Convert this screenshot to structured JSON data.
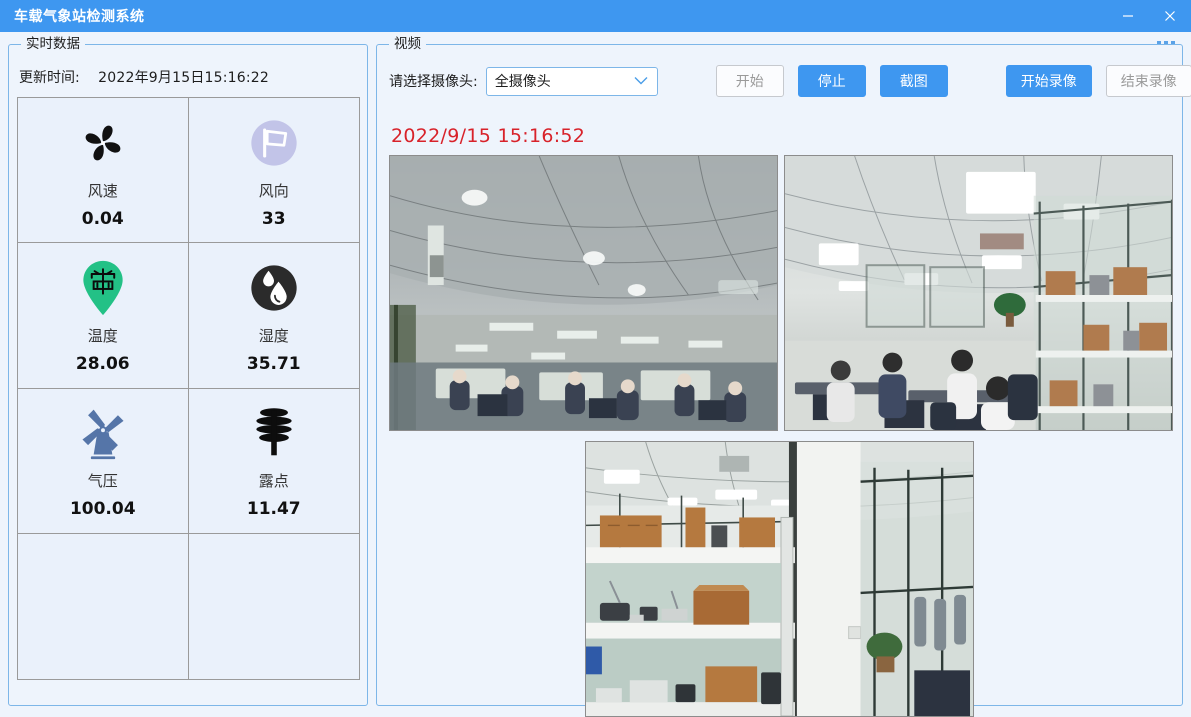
{
  "window": {
    "title": "车载气象站检测系统",
    "minimize_icon": "minimize-icon",
    "close_icon": "close-icon",
    "accent_color": "#3e97f0",
    "background_color": "#eef4fc"
  },
  "left_panel": {
    "group_label": "实时数据",
    "update_label": "更新时间:",
    "update_value": "2022年9月15日15:16:22",
    "sensors": [
      {
        "icon": "fan-icon",
        "name": "风速",
        "value": "0.04",
        "icon_color": "#111111"
      },
      {
        "icon": "flag-icon",
        "name": "风向",
        "value": "33",
        "icon_color": "#c2c4e8"
      },
      {
        "icon": "map-pin-icon",
        "name": "温度",
        "value": "28.06",
        "icon_color": "#23c186"
      },
      {
        "icon": "water-drop-icon",
        "name": "湿度",
        "value": "35.71",
        "icon_color": "#2b2b2b"
      },
      {
        "icon": "windmill-icon",
        "name": "气压",
        "value": "100.04",
        "icon_color": "#5575a8"
      },
      {
        "icon": "radiation-shield-icon",
        "name": "露点",
        "value": "11.47",
        "icon_color": "#111111"
      },
      {
        "icon": "",
        "name": "",
        "value": "",
        "icon_color": ""
      },
      {
        "icon": "",
        "name": "",
        "value": "",
        "icon_color": ""
      }
    ]
  },
  "right_panel": {
    "group_label": "视频",
    "camera_label": "请选择摄像头:",
    "camera_selected": "全摄像头",
    "chevron_icon": "chevron-down-icon",
    "buttons": [
      {
        "label": "开始",
        "state": "disabled"
      },
      {
        "label": "停止",
        "state": "active"
      },
      {
        "label": "截图",
        "state": "active"
      },
      {
        "label": "开始录像",
        "state": "active"
      },
      {
        "label": "结束录像",
        "state": "disabled"
      }
    ],
    "video_timestamp": "2022/9/15 15:16:52",
    "timestamp_color": "#d8222a",
    "feeds": [
      {
        "name": "camera-feed-1",
        "description": "office-ceiling-view"
      },
      {
        "name": "camera-feed-2",
        "description": "office-workstations-view"
      },
      {
        "name": "camera-feed-3",
        "description": "storage-shelves-view"
      }
    ]
  }
}
